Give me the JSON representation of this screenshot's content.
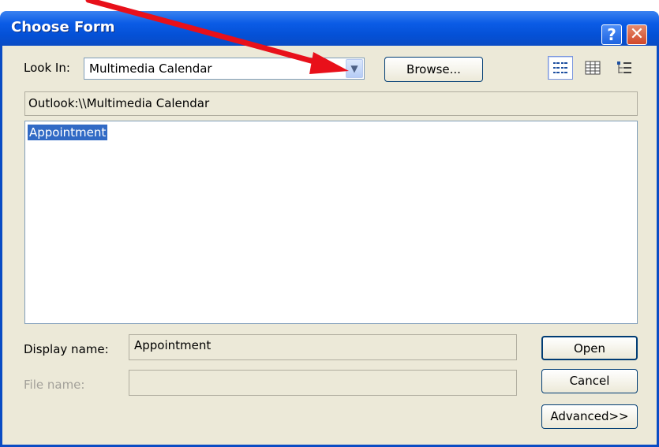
{
  "window": {
    "title": "Choose Form"
  },
  "titlebar": {
    "help_label": "?",
    "close_label": "✕"
  },
  "look_in": {
    "label": "Look In:",
    "value": "Multimedia Calendar"
  },
  "browse_label": "Browse...",
  "path": "Outlook:\\\\Multimedia Calendar",
  "list": {
    "items": [
      "Appointment"
    ]
  },
  "display_name": {
    "label": "Display name:",
    "value": "Appointment"
  },
  "file_name": {
    "label": "File name:",
    "value": ""
  },
  "buttons": {
    "open": "Open",
    "cancel": "Cancel",
    "advanced": "Advanced>>"
  },
  "colors": {
    "titlebar": "#0450d6",
    "dialog_bg": "#ece9d8",
    "selection": "#316ac5",
    "annotation_arrow": "#e8101a"
  },
  "view_buttons": [
    "list-view-icon",
    "details-view-icon",
    "properties-view-icon"
  ]
}
